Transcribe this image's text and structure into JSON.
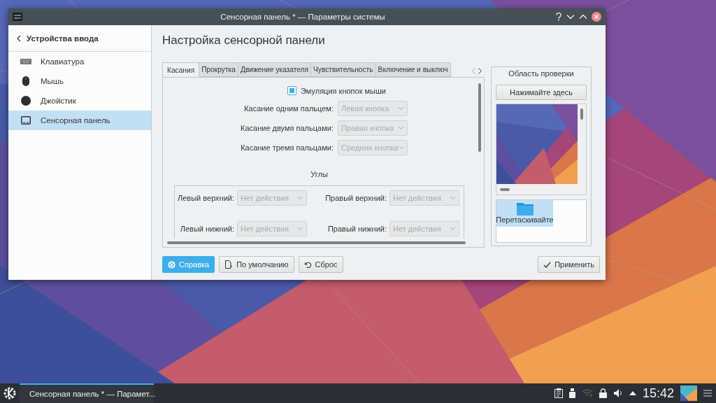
{
  "window": {
    "title": "Сенсорная панель * — Параметры системы"
  },
  "sidebar": {
    "back_label": "Устройства ввода",
    "items": [
      {
        "kind": "keyboard",
        "label": "Клавиатура",
        "selected": false
      },
      {
        "kind": "mouse",
        "label": "Мышь",
        "selected": false
      },
      {
        "kind": "joystick",
        "label": "Джойстик",
        "selected": false
      },
      {
        "kind": "touchpad",
        "label": "Сенсорная панель",
        "selected": true
      }
    ]
  },
  "page_title": "Настройка сенсорной панели",
  "tabs": [
    {
      "label": "Касания",
      "selected": true
    },
    {
      "label": "Прокрутка",
      "selected": false
    },
    {
      "label": "Движение указателя",
      "selected": false
    },
    {
      "label": "Чувствительность",
      "selected": false
    },
    {
      "label": "Включение и выключ",
      "selected": false
    }
  ],
  "emulation": {
    "label": "Эмуляция кнопок мыши",
    "checked": true
  },
  "taps": [
    {
      "label": "Касание одним пальцем:",
      "value": "Левая кнопка",
      "disabled": true
    },
    {
      "label": "Касание двумя пальцами:",
      "value": "Правая кнопка",
      "disabled": true
    },
    {
      "label": "Касание тремя пальцами:",
      "value": "Средняя кнопка",
      "disabled": true
    }
  ],
  "corners_title": "Углы",
  "corners": [
    {
      "label": "Левый верхний:",
      "value": "Нет действия",
      "disabled": true
    },
    {
      "label": "Правый верхний:",
      "value": "Нет действия",
      "disabled": true
    },
    {
      "label": "Левый нижний:",
      "value": "Нет действия",
      "disabled": true
    },
    {
      "label": "Правый нижний:",
      "value": "Нет действия",
      "disabled": true
    }
  ],
  "test_area": {
    "title": "Область проверки",
    "button": "Нажимайте здесь",
    "drag_item": {
      "label": "Перетаскивайте",
      "selected": true
    }
  },
  "buttons": [
    {
      "kind": "help",
      "label": "Справка",
      "focused": true
    },
    {
      "kind": "defaults",
      "label": "По умолчанию",
      "focused": false
    },
    {
      "kind": "reset",
      "label": "Сброс",
      "focused": false
    },
    {
      "kind": "apply",
      "label": "Применить",
      "focused": false
    }
  ],
  "taskbar": {
    "task": {
      "title": "Сенсорная панель * — Парамет...",
      "active": true
    },
    "clock": "15:42"
  }
}
